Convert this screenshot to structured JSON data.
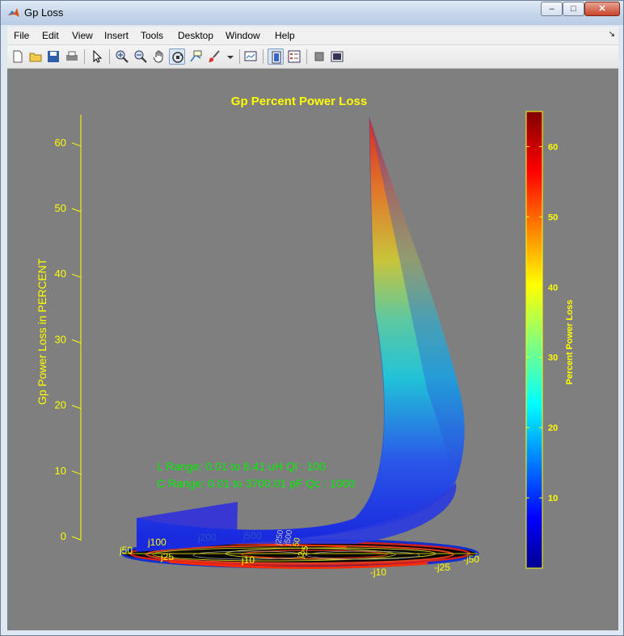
{
  "window": {
    "title": "Gp Loss"
  },
  "menu": [
    "File",
    "Edit",
    "View",
    "Insert",
    "Tools",
    "Desktop",
    "Window",
    "Help"
  ],
  "toolbar": [
    "new-figure-icon",
    "open-file-icon",
    "save-icon",
    "print-icon",
    "pointer-icon",
    "zoom-in-icon",
    "zoom-out-icon",
    "pan-icon",
    "rotate-3d-icon",
    "data-cursor-icon",
    "brush-icon",
    "link-plot-icon",
    "colorbar-icon",
    "legend-icon",
    "hide-plot-tools-icon",
    "show-plot-tools-icon"
  ],
  "plot": {
    "title": "Gp Percent Power Loss",
    "zlabel": "Gp Power Loss in PERCENT",
    "zticks": [
      "0",
      "10",
      "20",
      "30",
      "40",
      "50",
      "60"
    ],
    "annotation_line1": "L  Range: 0.01 to 8.41 uH  Ql : 100",
    "annotation_line2": "C Range: 0.01 to 3700.01 pF  Qc : 1000",
    "smith_labels": [
      "j50",
      "j100",
      "j200",
      "j500",
      "j25",
      "j10",
      "j250",
      "j500",
      "50",
      "25",
      "j2",
      "-j10",
      "-j25",
      "-j50"
    ],
    "colors": {
      "title": "#ffff00",
      "axis": "#ffff00",
      "annotation": "#00ee00",
      "background": "#7f7f7f"
    }
  },
  "colorbar": {
    "label": "Percent Power Loss",
    "ticks": [
      "10",
      "20",
      "30",
      "40",
      "50",
      "60"
    ],
    "range": [
      0,
      65
    ]
  },
  "chart_data": {
    "type": "surface",
    "title": "Gp Percent Power Loss",
    "zlabel": "Gp Power Loss in PERCENT",
    "zlim": [
      0,
      65
    ],
    "zticks": [
      0,
      10,
      20,
      30,
      40,
      50,
      60
    ],
    "colorbar_label": "Percent Power Loss",
    "colorbar_ticks": [
      10,
      20,
      30,
      40,
      50,
      60
    ],
    "surface_peak_z": 64,
    "legend_text": [
      "L  Range: 0.01 to 8.41 uH  Ql : 100",
      "C Range: 0.01 to 3700.01 pF  Qc : 1000"
    ]
  }
}
